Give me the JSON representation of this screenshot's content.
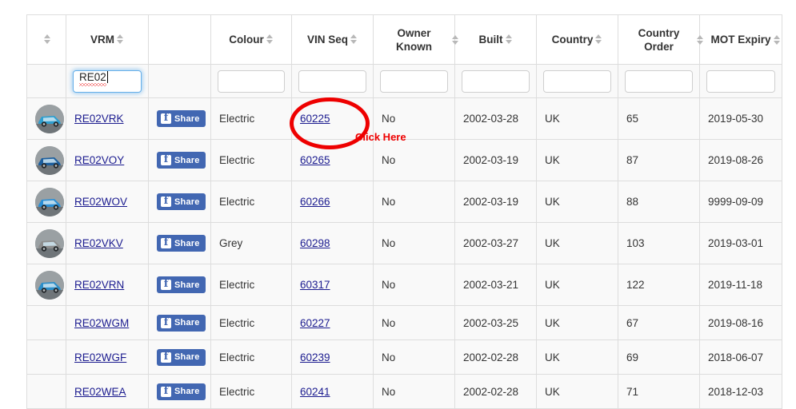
{
  "table": {
    "columns": [
      {
        "key": "thumb",
        "label": "",
        "sortable": true,
        "two_line": false
      },
      {
        "key": "vrm",
        "label": "VRM",
        "sortable": true,
        "two_line": false
      },
      {
        "key": "share",
        "label": "",
        "sortable": false,
        "two_line": false
      },
      {
        "key": "colour",
        "label": "Colour",
        "sortable": true,
        "two_line": false
      },
      {
        "key": "vin",
        "label": "VIN Seq",
        "sortable": true,
        "two_line": false
      },
      {
        "key": "owner",
        "label": "Owner Known",
        "sortable": true,
        "two_line": true
      },
      {
        "key": "built",
        "label": "Built",
        "sortable": true,
        "two_line": false
      },
      {
        "key": "country",
        "label": "Country",
        "sortable": true,
        "two_line": false
      },
      {
        "key": "corder",
        "label": "Country Order",
        "sortable": true,
        "two_line": true
      },
      {
        "key": "mot",
        "label": "MOT Expiry",
        "sortable": true,
        "two_line": true
      }
    ],
    "filters": {
      "vrm": {
        "value": "RE02",
        "placeholder": "",
        "focused": true,
        "misspelled": true
      },
      "colour": {
        "value": "",
        "placeholder": ""
      },
      "vin": {
        "value": "",
        "placeholder": ""
      },
      "owner": {
        "value": "",
        "placeholder": ""
      },
      "built": {
        "value": "",
        "placeholder": ""
      },
      "country": {
        "value": "",
        "placeholder": ""
      },
      "corder": {
        "value": "",
        "placeholder": ""
      },
      "mot": {
        "value": "",
        "placeholder": ""
      }
    },
    "share_button_label": "Share",
    "rows": [
      {
        "thumb": true,
        "thumb_color": "#2f9fd0",
        "vrm": "RE02VRK",
        "colour": "Electric",
        "vin": "60225",
        "owner": "No",
        "built": "2002-03-28",
        "country": "UK",
        "corder": "65",
        "mot": "2019-05-30"
      },
      {
        "thumb": true,
        "thumb_color": "#1d5f9e",
        "vrm": "RE02VOY",
        "colour": "Electric",
        "vin": "60265",
        "owner": "No",
        "built": "2002-03-19",
        "country": "UK",
        "corder": "87",
        "mot": "2019-08-26"
      },
      {
        "thumb": true,
        "thumb_color": "#2a8fd6",
        "vrm": "RE02WOV",
        "colour": "Electric",
        "vin": "60266",
        "owner": "No",
        "built": "2002-03-19",
        "country": "UK",
        "corder": "88",
        "mot": "9999-09-09"
      },
      {
        "thumb": true,
        "thumb_color": "#8d8d8d",
        "vrm": "RE02VKV",
        "colour": "Grey",
        "vin": "60298",
        "owner": "No",
        "built": "2002-03-27",
        "country": "UK",
        "corder": "103",
        "mot": "2019-03-01"
      },
      {
        "thumb": true,
        "thumb_color": "#2b8ec9",
        "vrm": "RE02VRN",
        "colour": "Electric",
        "vin": "60317",
        "owner": "No",
        "built": "2002-03-21",
        "country": "UK",
        "corder": "122",
        "mot": "2019-11-18"
      },
      {
        "thumb": false,
        "thumb_color": "",
        "vrm": "RE02WGM",
        "colour": "Electric",
        "vin": "60227",
        "owner": "No",
        "built": "2002-03-25",
        "country": "UK",
        "corder": "67",
        "mot": "2019-08-16"
      },
      {
        "thumb": false,
        "thumb_color": "",
        "vrm": "RE02WGF",
        "colour": "Electric",
        "vin": "60239",
        "owner": "No",
        "built": "2002-02-28",
        "country": "UK",
        "corder": "69",
        "mot": "2018-06-07"
      },
      {
        "thumb": false,
        "thumb_color": "",
        "vrm": "RE02WEA",
        "colour": "Electric",
        "vin": "60241",
        "owner": "No",
        "built": "2002-02-28",
        "country": "UK",
        "corder": "71",
        "mot": "2018-12-03"
      }
    ]
  },
  "annotation": {
    "callout_label": "Click Here",
    "highlight_color": "#ee0000",
    "target_cell": "60225"
  }
}
